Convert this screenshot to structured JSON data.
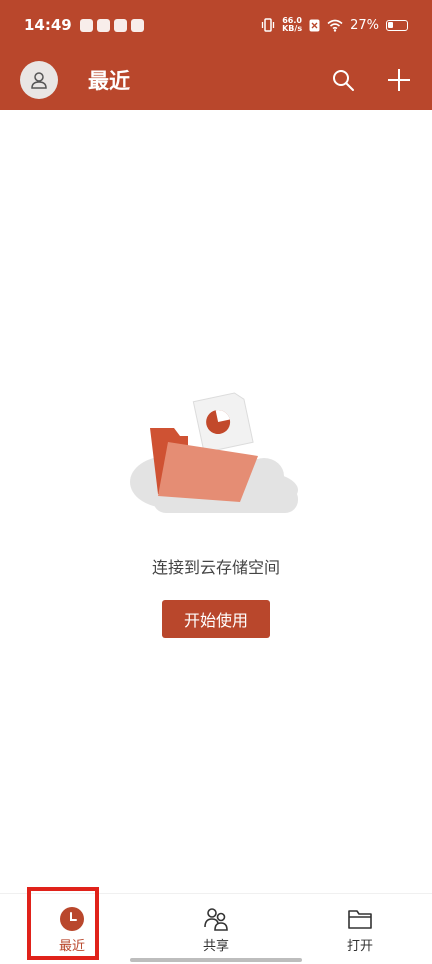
{
  "status_bar": {
    "time": "14:49",
    "net_speed_value": "66.0",
    "net_speed_unit": "KB/s",
    "battery_percent": "27%"
  },
  "header": {
    "title": "最近",
    "avatar_icon": "user-avatar-icon",
    "search_icon": "search-icon",
    "add_icon": "plus-icon"
  },
  "empty_state": {
    "message": "连接到云存储空间",
    "button_label": "开始使用",
    "illustration": "folder-cloud-illustration"
  },
  "bottom_nav": {
    "items": [
      {
        "label": "最近",
        "icon": "clock-icon",
        "active": true
      },
      {
        "label": "共享",
        "icon": "people-icon",
        "active": false
      },
      {
        "label": "打开",
        "icon": "folder-icon",
        "active": false
      }
    ]
  },
  "colors": {
    "accent": "#b9472c",
    "highlight": "#e0221a"
  }
}
